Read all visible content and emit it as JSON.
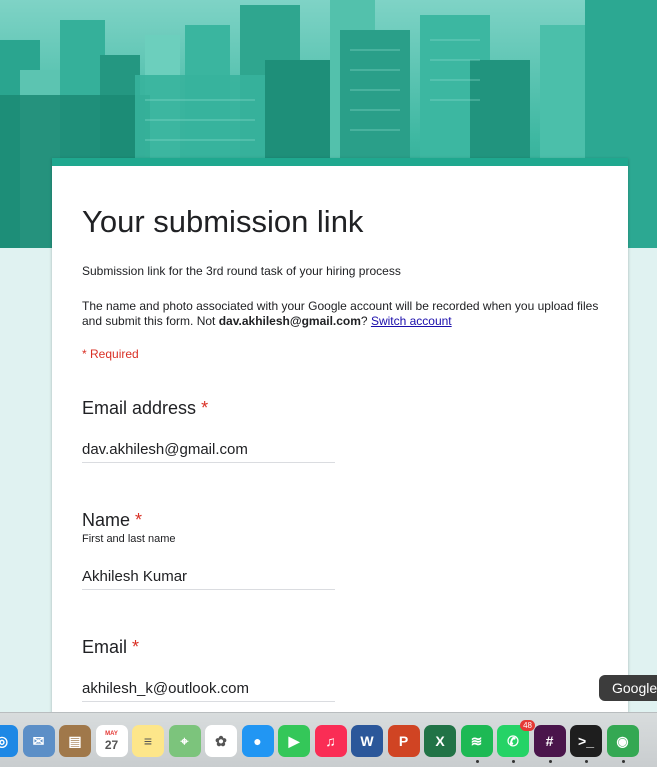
{
  "form": {
    "title": "Your submission link",
    "description": "Submission link for the 3rd round task of your hiring process",
    "notice_prefix": "The name and photo associated with your Google account will be recorded when you upload files and submit this form. Not ",
    "notice_email": "dav.akhilesh@gmail.com",
    "notice_suffix": "? ",
    "switch_account_label": "Switch account",
    "required_label": "* Required",
    "questions": [
      {
        "label": "Email address",
        "star": "*",
        "help": "",
        "value": "dav.akhilesh@gmail.com"
      },
      {
        "label": "Name",
        "star": "*",
        "help": "First and last name",
        "value": "Akhilesh Kumar"
      },
      {
        "label": "Email",
        "star": "*",
        "help": "",
        "value": "akhilesh_k@outlook.com"
      }
    ]
  },
  "tooltip": "Google",
  "dock": {
    "icons": [
      {
        "name": "safari-icon",
        "color": "#1e88e5",
        "glyph": "◎"
      },
      {
        "name": "preview-icon",
        "color": "#5c8fc7",
        "glyph": "✉"
      },
      {
        "name": "notes-book-icon",
        "color": "#a0784a",
        "glyph": "▤"
      },
      {
        "name": "calendar-icon",
        "color": "#ffffff",
        "glyph": "27",
        "month": "MAY"
      },
      {
        "name": "notes-icon",
        "color": "#fde68a",
        "glyph": "≡"
      },
      {
        "name": "maps-icon",
        "color": "#7cc47c",
        "glyph": "⌖"
      },
      {
        "name": "photos-icon",
        "color": "#ffffff",
        "glyph": "✿"
      },
      {
        "name": "messages-icon",
        "color": "#2196f3",
        "glyph": "●"
      },
      {
        "name": "facetime-icon",
        "color": "#34c759",
        "glyph": "▶"
      },
      {
        "name": "music-icon",
        "color": "#fa2d55",
        "glyph": "♫"
      },
      {
        "name": "word-icon",
        "color": "#2b579a",
        "glyph": "W"
      },
      {
        "name": "powerpoint-icon",
        "color": "#d04423",
        "glyph": "P"
      },
      {
        "name": "excel-icon",
        "color": "#217346",
        "glyph": "X"
      },
      {
        "name": "spotify-icon",
        "color": "#1db954",
        "glyph": "≋"
      },
      {
        "name": "whatsapp-icon",
        "color": "#25d366",
        "glyph": "✆",
        "badge": "48"
      },
      {
        "name": "slack-icon",
        "color": "#4a154b",
        "glyph": "#"
      },
      {
        "name": "terminal-icon",
        "color": "#1e1e1e",
        "glyph": ">_"
      },
      {
        "name": "chrome-icon",
        "color": "#34a853",
        "glyph": "◉"
      }
    ]
  }
}
